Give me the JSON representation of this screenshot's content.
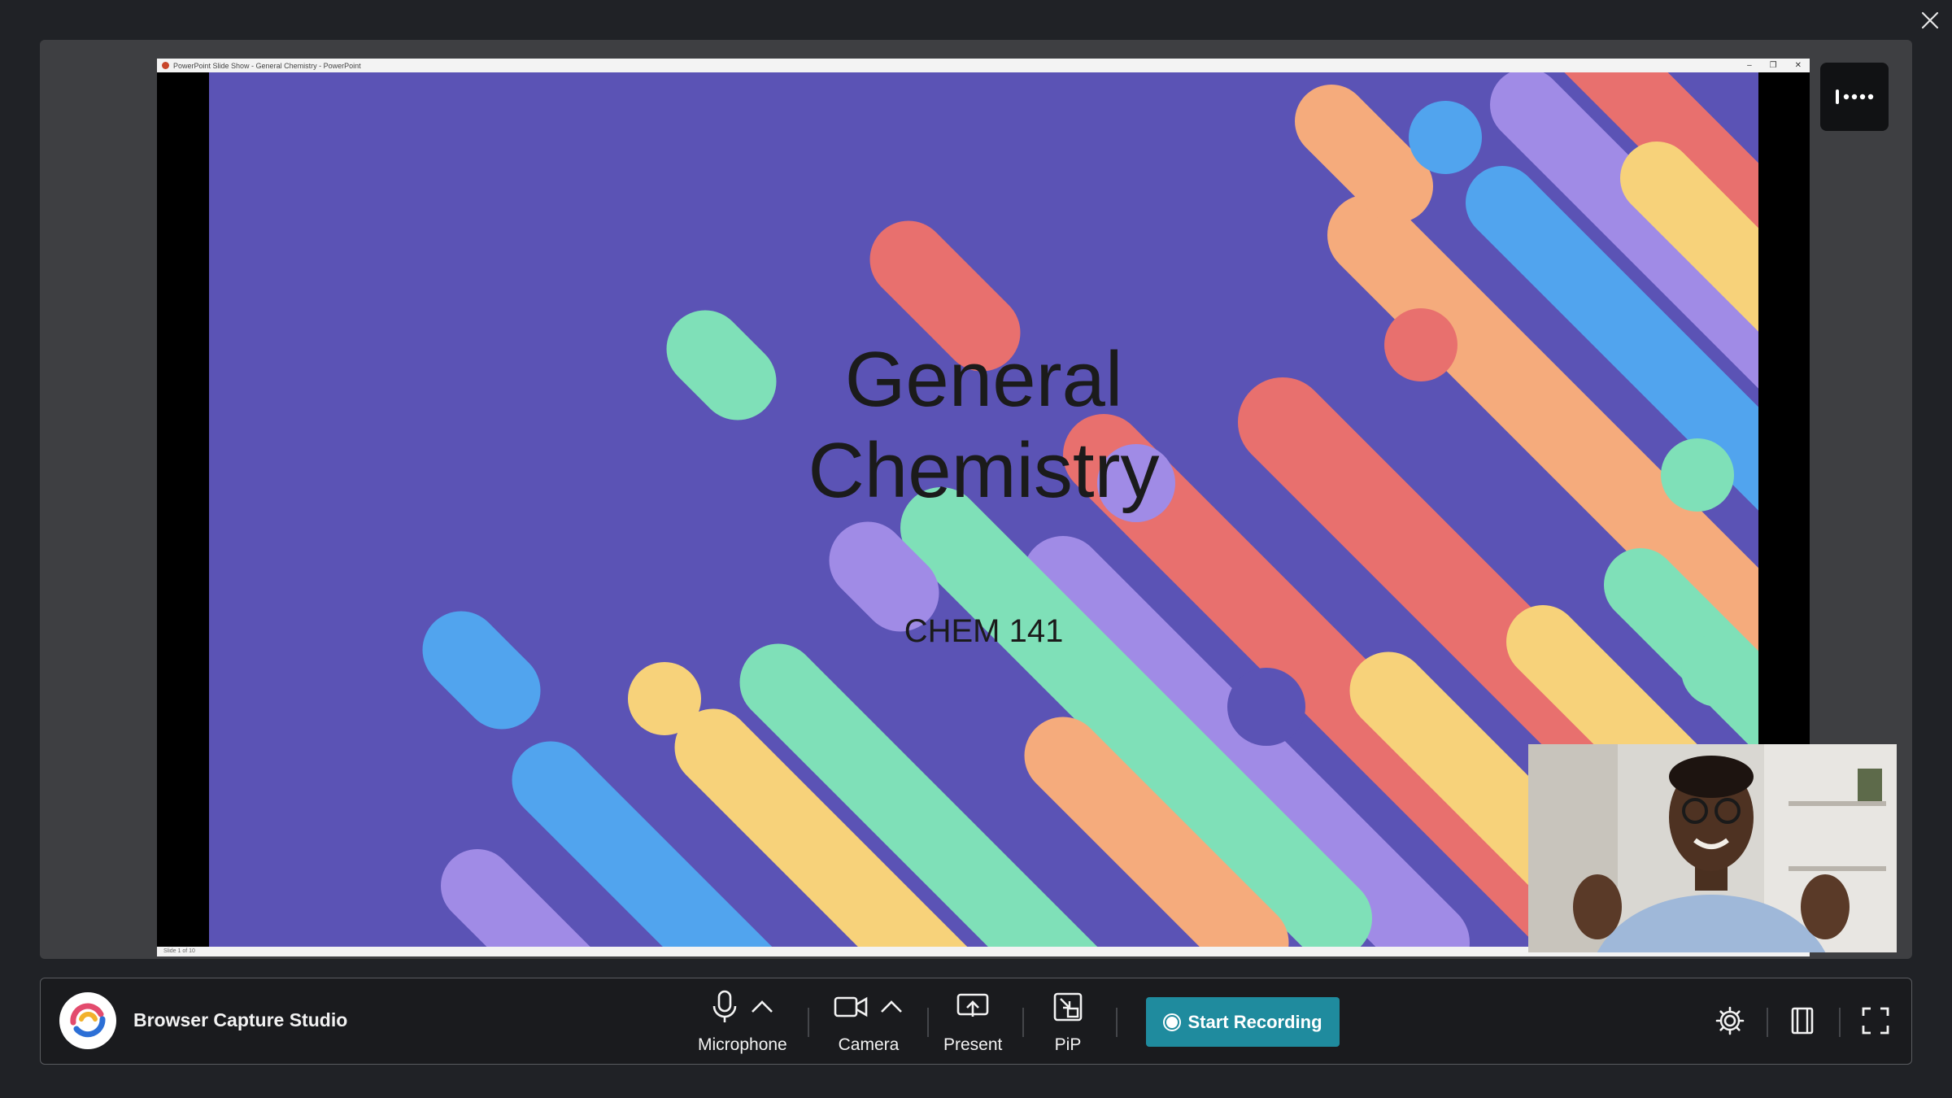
{
  "window": {
    "close_icon": "close-icon"
  },
  "slide_window": {
    "title_bar_text": "PowerPoint Slide Show  -  General Chemistry - PowerPoint",
    "status_text": "Slide 1 of 10",
    "controls": [
      "–",
      "❐",
      "✕"
    ]
  },
  "slide": {
    "title_line1": "General",
    "title_line2": "Chemistry",
    "subtitle": "CHEM 141",
    "background_color": "#5b53b5"
  },
  "toolbar": {
    "app_name": "Browser Capture Studio",
    "controls": [
      {
        "label": "Microphone",
        "icon": "microphone-icon",
        "has_menu": true
      },
      {
        "label": "Camera",
        "icon": "camera-icon",
        "has_menu": true
      },
      {
        "label": "Present",
        "icon": "present-icon"
      },
      {
        "label": "PiP",
        "icon": "pip-icon"
      }
    ],
    "record_label": "Start Recording",
    "record_color": "#1f8b9e",
    "right_icons": [
      "settings-icon",
      "layout-icon",
      "fullscreen-icon"
    ]
  },
  "more_button_icon": "more-icon"
}
